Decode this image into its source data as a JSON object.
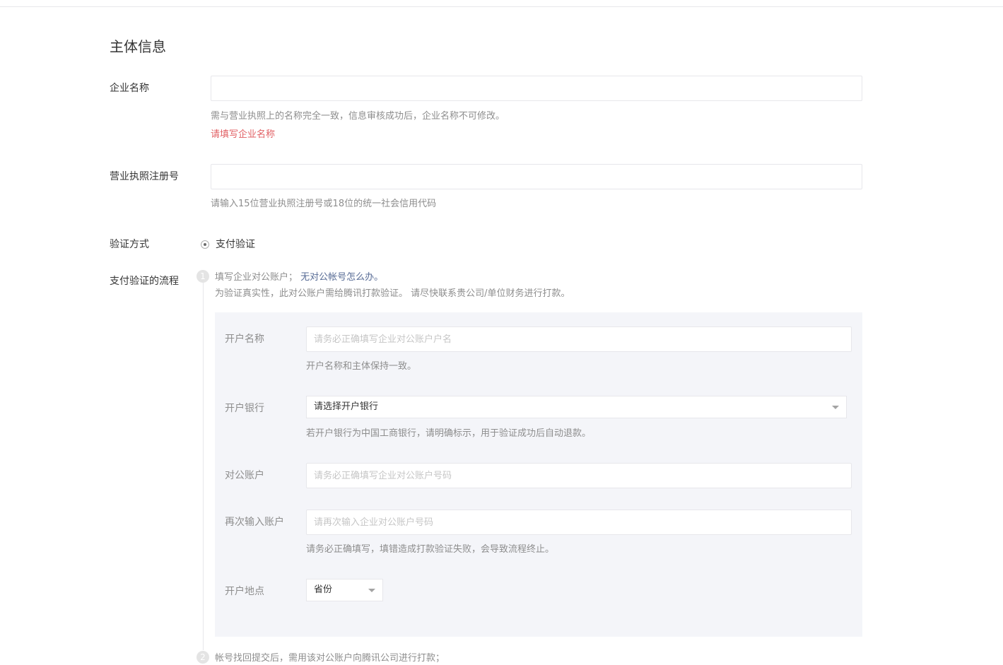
{
  "section": {
    "title": "主体信息"
  },
  "company_name": {
    "label": "企业名称",
    "value": "",
    "placeholder": "",
    "tip": "需与营业执照上的名称完全一致，信息审核成功后，企业名称不可修改。",
    "error": "请填写企业名称"
  },
  "license": {
    "label": "营业执照注册号",
    "value": "",
    "placeholder": "",
    "tip": "请输入15位营业执照注册号或18位的统一社会信用代码"
  },
  "verify_method": {
    "label": "验证方式",
    "option": "支付验证",
    "selected": true
  },
  "flow": {
    "label": "支付验证的流程",
    "step1": {
      "badge": "1",
      "text": "填写企业对公账户；",
      "link": "无对公帐号怎么办。",
      "desc": "为验证真实性，此对公账户需给腾讯打款验证。 请尽快联系贵公司/单位财务进行打款。"
    },
    "step2": {
      "badge": "2",
      "text": "帐号找回提交后，需用该对公账户向腾讯公司进行打款；"
    }
  },
  "form": {
    "account_name": {
      "label": "开户名称",
      "value": "",
      "placeholder": "请务必正确填写企业对公账户户名",
      "tip": "开户名称和主体保持一致。"
    },
    "bank": {
      "label": "开户银行",
      "selected": "请选择开户银行",
      "tip": "若开户银行为中国工商银行，请明确标示，用于验证成功后自动退款。"
    },
    "account": {
      "label": "对公账户",
      "value": "",
      "placeholder": "请务必正确填写企业对公账户号码"
    },
    "account_confirm": {
      "label": "再次输入账户",
      "value": "",
      "placeholder": "请再次输入企业对公账户号码",
      "tip": "请务必正确填写，填错造成打款验证失败，会导致流程终止。"
    },
    "location": {
      "label": "开户地点",
      "selected": "省份"
    }
  }
}
